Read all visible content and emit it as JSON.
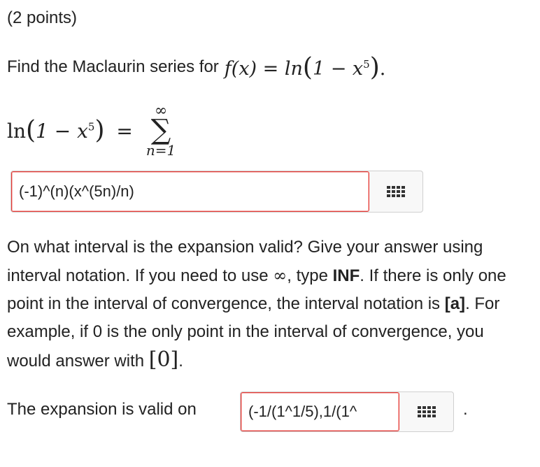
{
  "points": "(2 points)",
  "prompt": {
    "lead": "Find the Maclaurin series for",
    "fx": "f(x) = ln",
    "arg": "1 − x",
    "exp": "5",
    "end": "."
  },
  "lhs": {
    "fn": "ln",
    "arg": "1 − x",
    "exp": "5",
    "eq": "="
  },
  "sum": {
    "upper": "∞",
    "sigma": "∑",
    "lower": "n=1"
  },
  "answer1": {
    "value": "(-1)^(n)(x^(5n)/n)",
    "kbd_icon": "keyboard-grid-icon"
  },
  "instructions": {
    "p1": "On what interval is the expansion valid? Give your answer using interval notation. If you need to use ",
    "inf_symbol": "∞",
    "p2": ", type ",
    "inf_word": "INF",
    "p3": ". If there is only one point in the interval of convergence, the interval notation is ",
    "a_word": "[a]",
    "p4": ". For example, if 0 is the only point in the interval of convergence, you would answer with ",
    "zero": "[0]",
    "p5": "."
  },
  "valid_label": "The expansion is valid on",
  "answer2": {
    "value": "(-1/(1^1/5),1/(1^",
    "kbd_icon": "keyboard-grid-icon"
  },
  "period": "."
}
